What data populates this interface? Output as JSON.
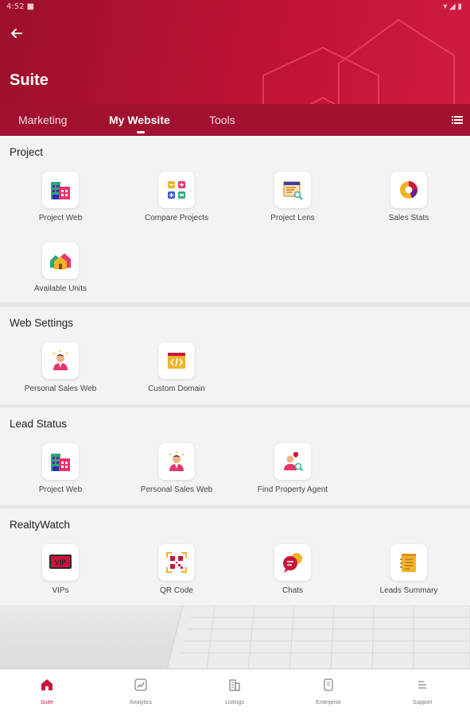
{
  "status_bar": {
    "time": "4:52 ■",
    "icons": "▾ ◢ ▮"
  },
  "header": {
    "title": "Suite",
    "back_icon": "arrow-left-icon"
  },
  "tabs": [
    {
      "label": "Marketing",
      "active": false
    },
    {
      "label": "My Website",
      "active": true
    },
    {
      "label": "Tools",
      "active": false
    }
  ],
  "sections": {
    "project": {
      "title": "Project",
      "items": [
        {
          "label": "Project Web",
          "icon": "buildings-icon"
        },
        {
          "label": "Compare Projects",
          "icon": "compare-icon"
        },
        {
          "label": "Project Lens",
          "icon": "lens-icon"
        },
        {
          "label": "Sales Stats",
          "icon": "pie-chart-icon"
        },
        {
          "label": "Available Units",
          "icon": "houses-icon"
        }
      ]
    },
    "web_settings": {
      "title": "Web Settings",
      "items": [
        {
          "label": "Personal Sales Web",
          "icon": "agent-icon"
        },
        {
          "label": "Custom Domain",
          "icon": "code-window-icon"
        }
      ]
    },
    "lead_status": {
      "title": "Lead Status",
      "items": [
        {
          "label": "Project Web",
          "icon": "buildings-icon"
        },
        {
          "label": "Personal Sales Web",
          "icon": "agent-icon"
        },
        {
          "label": "Find Property Agent",
          "icon": "find-agent-icon"
        }
      ]
    },
    "realtywatch": {
      "title": "RealtyWatch",
      "items": [
        {
          "label": "VIPs",
          "icon": "vip-icon"
        },
        {
          "label": "QR Code",
          "icon": "qr-code-icon"
        },
        {
          "label": "Chats",
          "icon": "chat-icon"
        },
        {
          "label": "Leads Summary",
          "icon": "notepad-icon"
        }
      ]
    }
  },
  "bottom_nav": [
    {
      "label": "Suite",
      "active": true
    },
    {
      "label": "Analytics",
      "active": false
    },
    {
      "label": "Listings",
      "active": false
    },
    {
      "label": "Enterprise",
      "active": false
    },
    {
      "label": "Support",
      "active": false
    }
  ],
  "colors": {
    "brand": "#c8163a",
    "header_dark": "#9c0f2c",
    "tab_bar": "#a2102f"
  }
}
